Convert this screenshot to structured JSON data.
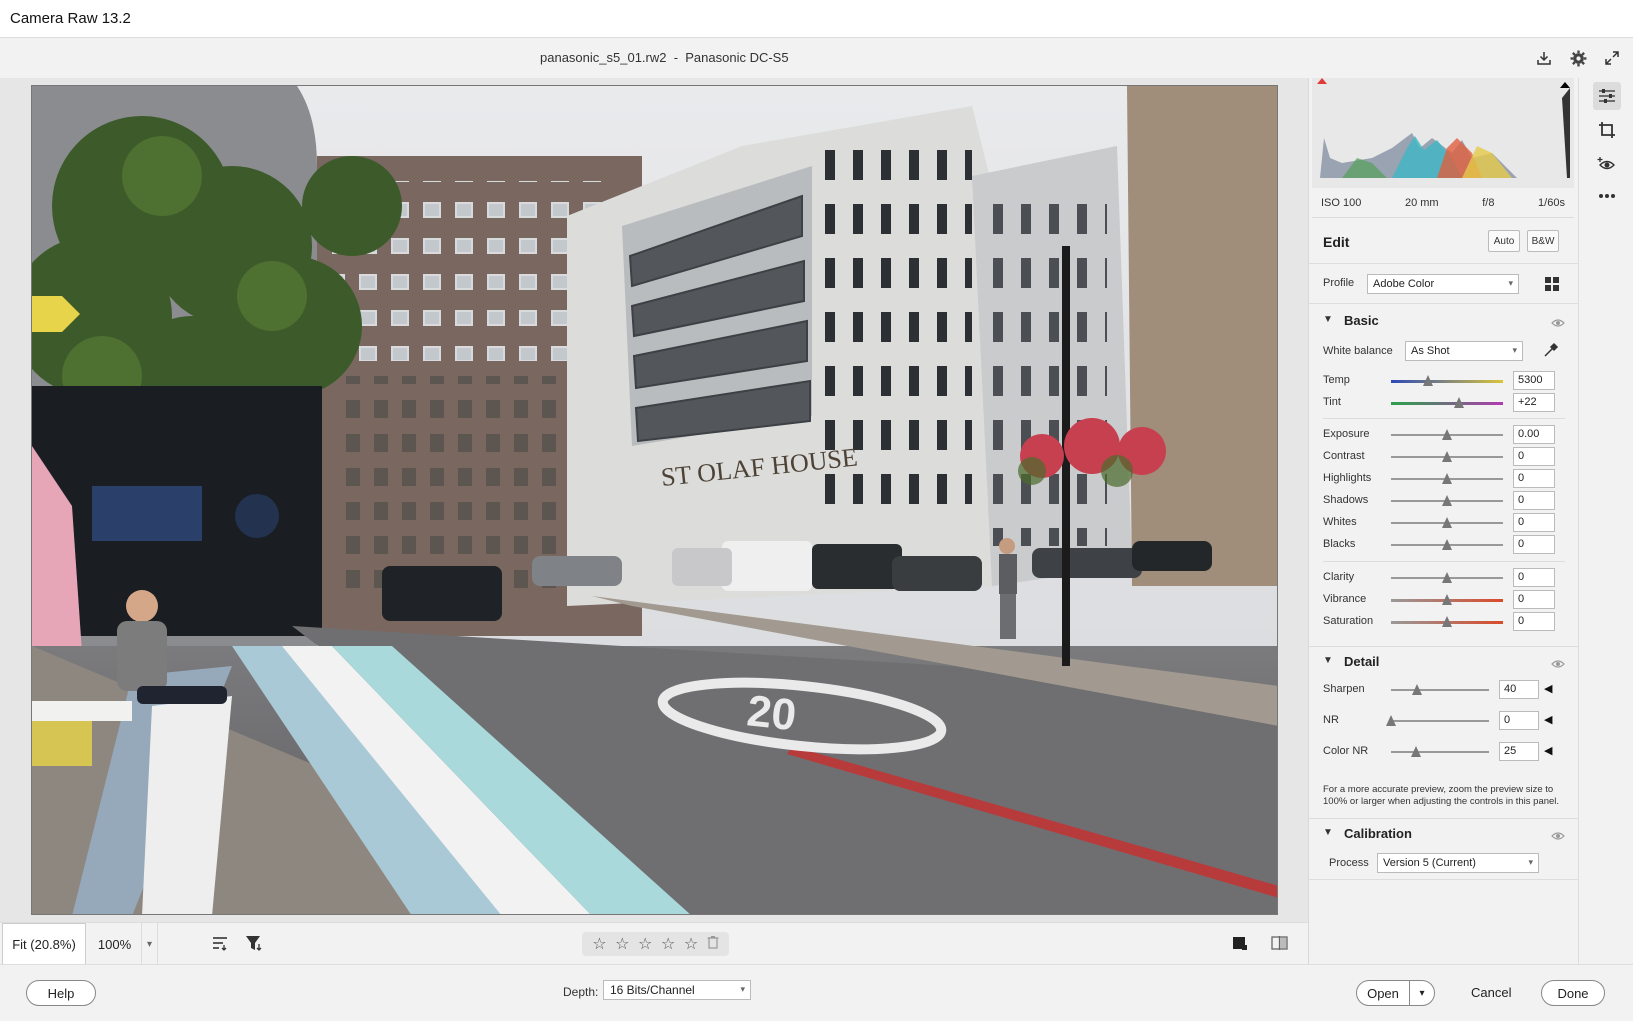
{
  "window": {
    "title": "Camera Raw 13.2"
  },
  "file": {
    "title": "panasonic_s5_01.rw2  -  Panasonic DC-S5"
  },
  "top_icons": [
    "save-icon",
    "gear-icon",
    "fullscreen-icon"
  ],
  "zoom": {
    "fit_label": "Fit (20.8%)",
    "percent_label": "100%"
  },
  "rating": {
    "stars": 0,
    "max": 5
  },
  "footer": {
    "help_label": "Help",
    "depth_label": "Depth:",
    "depth_value": "16 Bits/Channel",
    "open_label": "Open",
    "cancel_label": "Cancel",
    "done_label": "Done"
  },
  "camera_info": {
    "iso": "ISO 100",
    "focal": "20 mm",
    "aperture": "f/8",
    "shutter": "1/60s"
  },
  "edit": {
    "title": "Edit",
    "auto_label": "Auto",
    "bw_label": "B&W",
    "profile_label": "Profile",
    "profile_value": "Adobe Color"
  },
  "basic": {
    "title": "Basic",
    "wb_label": "White balance",
    "wb_value": "As Shot",
    "sliders": [
      {
        "label": "Temp",
        "value": "5300",
        "level": 0.33
      },
      {
        "label": "Tint",
        "value": "+22",
        "level": 0.61
      },
      {
        "label": "Exposure",
        "value": "0.00",
        "level": 0.5
      },
      {
        "label": "Contrast",
        "value": "0",
        "level": 0.5
      },
      {
        "label": "Highlights",
        "value": "0",
        "level": 0.5
      },
      {
        "label": "Shadows",
        "value": "0",
        "level": 0.5
      },
      {
        "label": "Whites",
        "value": "0",
        "level": 0.5
      },
      {
        "label": "Blacks",
        "value": "0",
        "level": 0.5
      },
      {
        "label": "Clarity",
        "value": "0",
        "level": 0.5
      },
      {
        "label": "Vibrance",
        "value": "0",
        "level": 0.5
      },
      {
        "label": "Saturation",
        "value": "0",
        "level": 0.5
      }
    ]
  },
  "detail": {
    "title": "Detail",
    "sliders": [
      {
        "label": "Sharpen",
        "value": "40",
        "level": 0.27
      },
      {
        "label": "NR",
        "value": "0",
        "level": 0.0
      },
      {
        "label": "Color NR",
        "value": "25",
        "level": 0.25
      }
    ],
    "note": "For a more accurate preview, zoom the preview size to 100% or larger when adjusting the controls in this panel."
  },
  "calibration": {
    "title": "Calibration",
    "process_label": "Process",
    "process_value": "Version 5 (Current)"
  },
  "photo_text": {
    "building_sign": "ST OLAF HOUSE",
    "road_marking": "20"
  },
  "colors": {
    "accent": "#1473e6",
    "panel_bg": "#f2f2f2",
    "canvas_bg": "#e6e6e6"
  }
}
